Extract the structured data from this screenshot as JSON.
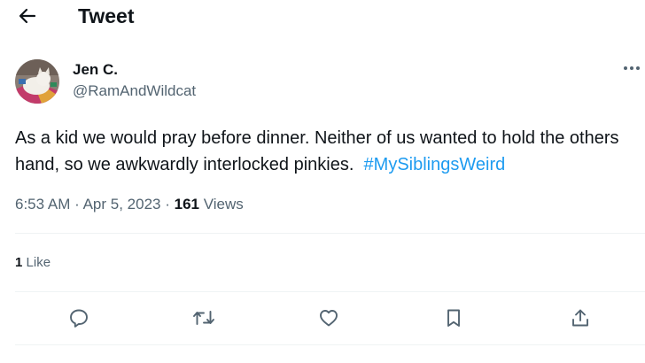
{
  "header": {
    "title": "Tweet",
    "back_icon": "arrow-left-icon"
  },
  "author": {
    "name": "Jen C.",
    "handle": "@RamAndWildcat",
    "avatar": "cat-photo-avatar"
  },
  "tweet": {
    "text": "As a kid we would pray before dinner. Neither of us wanted to hold the others hand, so we awkwardly interlocked pinkies.",
    "hashtag": "#MySiblingsWeird"
  },
  "meta": {
    "time": "6:53 AM",
    "separator": "·",
    "date": "Apr 5, 2023",
    "views_count": "161",
    "views_label": "Views"
  },
  "stats": {
    "likes_count": "1",
    "likes_label": "Like"
  },
  "actions": [
    {
      "name": "reply",
      "icon": "reply-icon"
    },
    {
      "name": "retweet",
      "icon": "retweet-icon"
    },
    {
      "name": "like",
      "icon": "heart-icon"
    },
    {
      "name": "bookmark",
      "icon": "bookmark-icon"
    },
    {
      "name": "share",
      "icon": "share-icon"
    }
  ],
  "colors": {
    "text": "#0f1419",
    "secondary": "#536471",
    "link": "#1d9bf0",
    "divider": "#eff3f4"
  }
}
